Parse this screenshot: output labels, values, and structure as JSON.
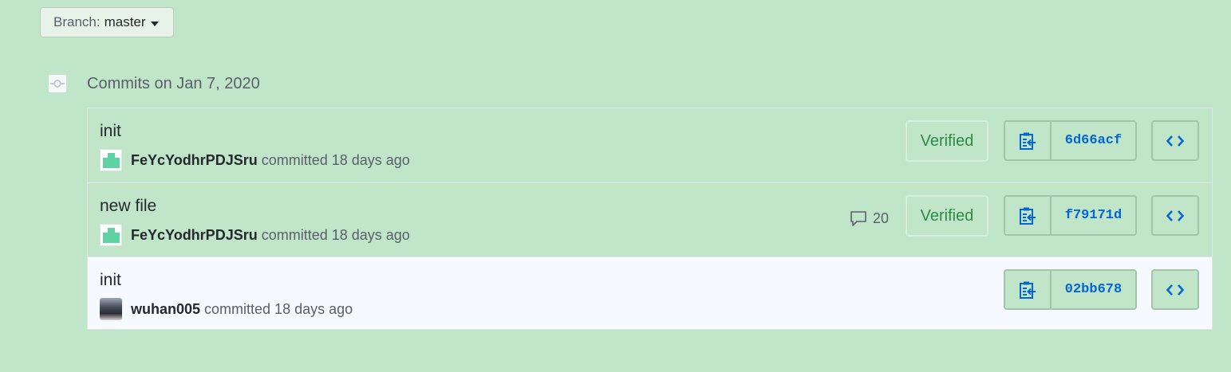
{
  "branch": {
    "prefix": "Branch:",
    "name": "master"
  },
  "group": {
    "title": "Commits on Jan 7, 2020"
  },
  "commits": [
    {
      "message": "init",
      "author": "FeYcYodhrPDJSru",
      "committed_text": "committed 18 days ago",
      "verified": "Verified",
      "comments": "",
      "sha": "6d66acf"
    },
    {
      "message": "new file",
      "author": "FeYcYodhrPDJSru",
      "committed_text": "committed 18 days ago",
      "verified": "Verified",
      "comments": "20",
      "sha": "f79171d"
    },
    {
      "message": "init",
      "author": "wuhan005",
      "committed_text": "committed 18 days ago",
      "verified": "",
      "comments": "",
      "sha": "02bb678"
    }
  ],
  "icons": {
    "branch_caret": "caret-down-icon",
    "group": "commit-node-icon",
    "comment": "comment-icon",
    "copy": "clipboard-copy-icon",
    "browse": "code-icon"
  },
  "colors": {
    "background": "#c1e5c8",
    "link": "#0366d6",
    "verified": "#2a8c47",
    "identicon": "#5fd3a3"
  }
}
